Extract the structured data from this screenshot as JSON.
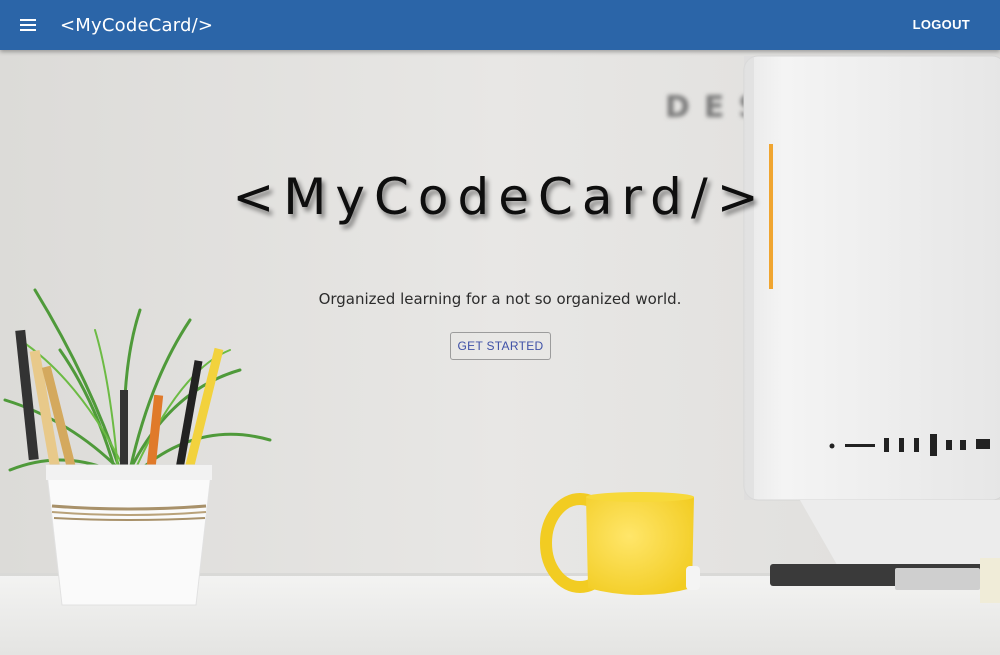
{
  "header": {
    "menu_icon": "menu-icon",
    "brand": "<MyCodeCard/>",
    "logout_label": "LOGOUT"
  },
  "hero": {
    "title": "<MyCodeCard/>",
    "tagline": "Organized learning for a not so organized world.",
    "cta_label": "GET STARTED",
    "background_text": "DES"
  },
  "colors": {
    "appbar": "#2b65a8",
    "cursor": "#f0a530",
    "cta_text": "#3f51a7"
  }
}
